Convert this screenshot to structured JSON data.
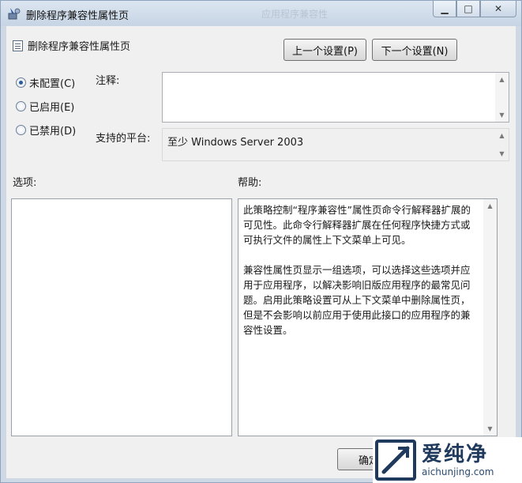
{
  "window": {
    "title": "删除程序兼容性属性页",
    "background_title": "应用程序兼容性"
  },
  "controls": {
    "minimize_icon": "minimize-icon",
    "maximize_icon": "maximize-icon",
    "close_icon": "close-icon"
  },
  "header": {
    "setting_name": "删除程序兼容性属性页",
    "prev_button": "上一个设置(P)",
    "next_button": "下一个设置(N)"
  },
  "state": {
    "options": [
      {
        "label": "未配置(C)",
        "checked": true
      },
      {
        "label": "已启用(E)",
        "checked": false
      },
      {
        "label": "已禁用(D)",
        "checked": false
      }
    ]
  },
  "comment": {
    "label": "注释:",
    "value": ""
  },
  "platform": {
    "label": "支持的平台:",
    "value": "至少 Windows Server 2003"
  },
  "options_panel": {
    "label": "选项:"
  },
  "help": {
    "label": "帮助:",
    "paragraphs": [
      "此策略控制“程序兼容性”属性页命令行解释器扩展的可见性。此命令行解释器扩展在任何程序快捷方式或可执行文件的属性上下文菜单上可见。",
      "兼容性属性页显示一组选项，可以选择这些选项并应用于应用程序，以解决影响旧版应用程序的最常见问题。启用此策略设置可从上下文菜单中删除属性页，但是不会影响以前应用于使用此接口的应用程序的兼容性设置。"
    ]
  },
  "footer": {
    "ok_button": "确定"
  },
  "watermark": {
    "cn": "爱纯净",
    "en": "aichunjing.com"
  },
  "colors": {
    "accent": "#2b5a9c",
    "client_bg": "#f0f0f0",
    "frame": "#cfd9e6"
  }
}
